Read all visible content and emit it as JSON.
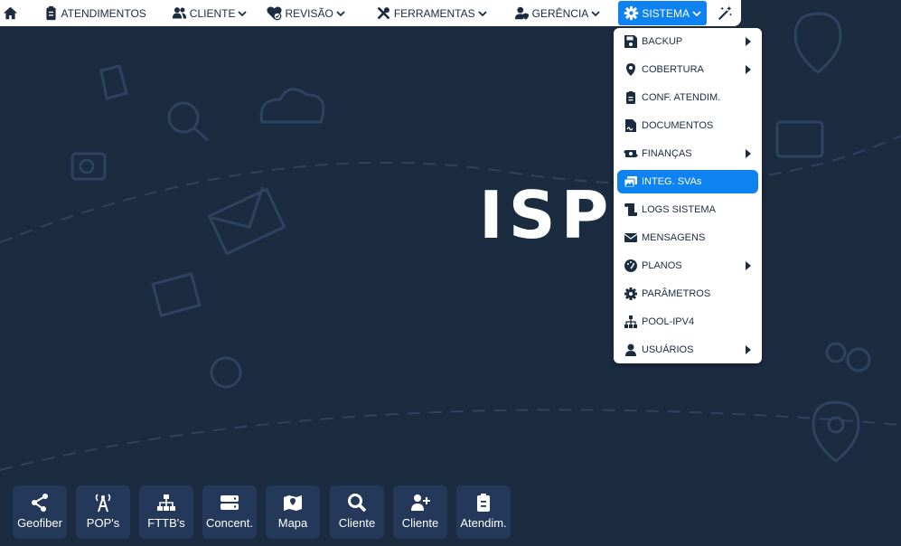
{
  "logo": "ISP",
  "nav": {
    "home_icon": "home-icon",
    "atendimentos": "ATENDIMENTOS",
    "cliente": "CLIENTE",
    "revisao": "REVISÃO",
    "ferramentas": "FERRAMENTAS",
    "gerencia": "GERÊNCIA",
    "sistema": "SISTEMA",
    "magic_icon": "magic-wand-icon"
  },
  "menu": {
    "items": [
      {
        "label": "BACKUP",
        "icon": "save-icon",
        "submenu": true
      },
      {
        "label": "COBERTURA",
        "icon": "map-pin-icon",
        "submenu": true
      },
      {
        "label": "CONF. ATENDIM.",
        "icon": "clipboard-icon",
        "submenu": false
      },
      {
        "label": "DOCUMENTOS",
        "icon": "document-sign-icon",
        "submenu": false
      },
      {
        "label": "FINANÇAS",
        "icon": "money-exchange-icon",
        "submenu": true
      },
      {
        "label": "INTEG. SVAs",
        "icon": "photo-images-icon",
        "submenu": false,
        "highlighted": true
      },
      {
        "label": "LOGS SISTEMA",
        "icon": "scroll-icon",
        "submenu": false
      },
      {
        "label": "MENSAGENS",
        "icon": "envelope-icon",
        "submenu": false
      },
      {
        "label": "PLANOS",
        "icon": "speedometer-icon",
        "submenu": true
      },
      {
        "label": "PARÂMETROS",
        "icon": "gear-icon",
        "submenu": false
      },
      {
        "label": "POOL-IPV4",
        "icon": "sitemap-icon",
        "submenu": false
      },
      {
        "label": "USUÁRIOS",
        "icon": "user-icon",
        "submenu": true
      }
    ]
  },
  "quick": {
    "geofiber": "Geofiber",
    "pops": "POP's",
    "fttbs": "FTTB's",
    "concent": "Concent.",
    "mapa": "Mapa",
    "cliente_busca": "Cliente",
    "cliente_add": "Cliente",
    "atendim": "Atendim."
  },
  "colors": {
    "background": "#1b2b40",
    "accent": "#0d82f0",
    "button": "#24395a"
  }
}
